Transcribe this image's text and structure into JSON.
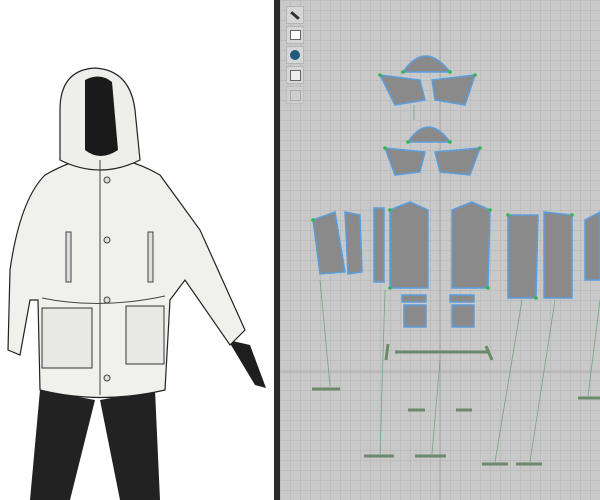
{
  "toolbar": {
    "tools": [
      {
        "icon": "brush-icon"
      },
      {
        "icon": "garment-icon"
      },
      {
        "icon": "info-icon"
      },
      {
        "icon": "pattern-icon"
      },
      {
        "icon": "disabled-tool-icon"
      }
    ]
  },
  "colors": {
    "pattern_fill": "#8a8a8a",
    "pattern_outline": "#4a8fd6",
    "point": "#2fb84a",
    "grid_bg": "#c9c9c9",
    "divider": "#2b2b2b"
  }
}
